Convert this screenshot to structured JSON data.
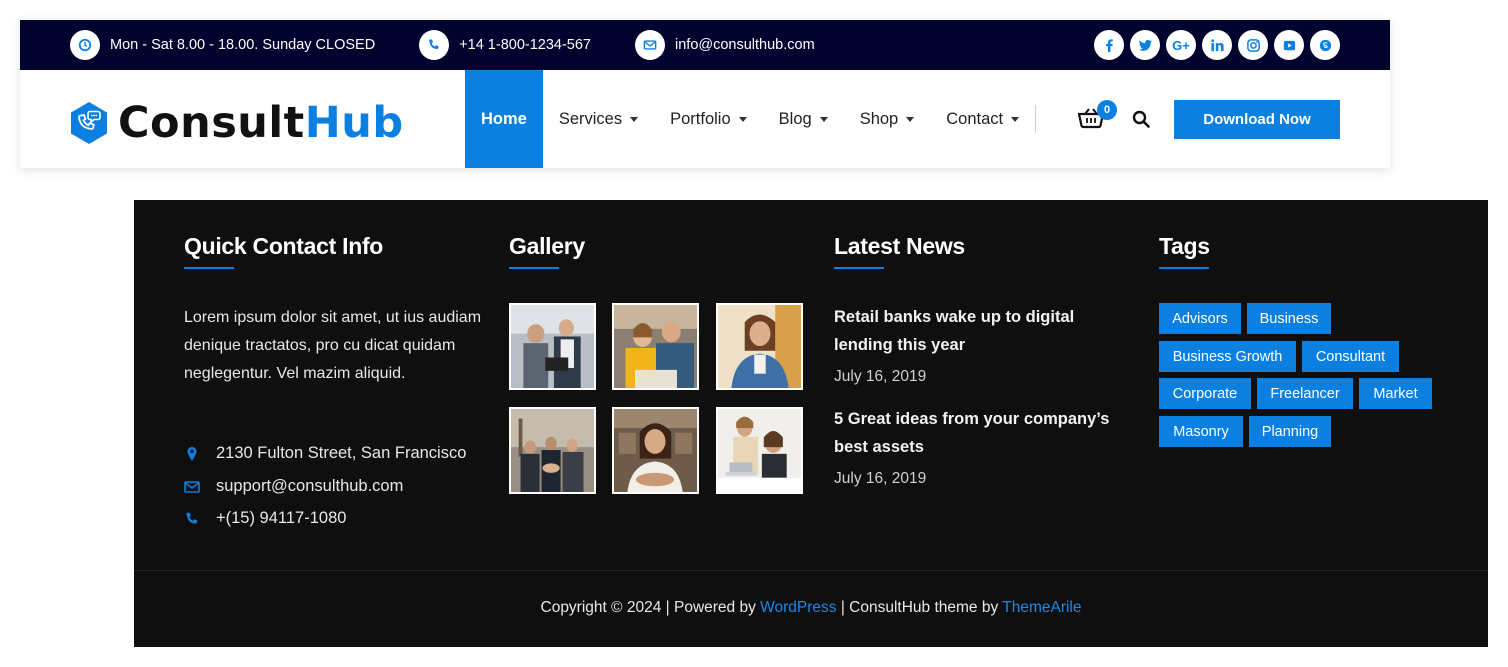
{
  "topbar": {
    "hours": "Mon - Sat 8.00 - 18.00. Sunday CLOSED",
    "phone": "+14 1-800-1234-567",
    "email": "info@consulthub.com",
    "social_icons": [
      "facebook-icon",
      "twitter-icon",
      "google-plus-icon",
      "linkedin-icon",
      "instagram-icon",
      "youtube-icon",
      "skype-icon"
    ]
  },
  "logo": {
    "part1": "Consult",
    "part2": "Hub"
  },
  "nav": {
    "items": [
      {
        "label": "Home",
        "active": true,
        "dropdown": false
      },
      {
        "label": "Services",
        "dropdown": true
      },
      {
        "label": "Portfolio",
        "dropdown": true
      },
      {
        "label": "Blog",
        "dropdown": true
      },
      {
        "label": "Shop",
        "dropdown": true
      },
      {
        "label": "Contact",
        "dropdown": true
      }
    ],
    "cart_count": "0",
    "download_label": "Download Now"
  },
  "footer": {
    "contact": {
      "title": "Quick Contact Info",
      "text": "Lorem ipsum dolor sit amet, ut ius audiam denique tractatos, pro cu dicat quidam neglegentur. Vel mazim aliquid.",
      "address": "2130 Fulton Street, San Francisco",
      "email": "support@consulthub.com",
      "phone": "+(15) 94117-1080"
    },
    "gallery": {
      "title": "Gallery",
      "count": 6
    },
    "news": {
      "title": "Latest News",
      "items": [
        {
          "title": "Retail banks wake up to digital lending this year",
          "date": "July 16, 2019"
        },
        {
          "title": "5 Great ideas from your company’s best assets",
          "date": "July 16, 2019"
        }
      ]
    },
    "tags": {
      "title": "Tags",
      "items": [
        "Advisors",
        "Business",
        "Business Growth",
        "Consultant",
        "Corporate",
        "Freelancer",
        "Market",
        "Masonry",
        "Planning"
      ]
    },
    "copyright": {
      "prefix": "Copyright © 2024 | Powered by ",
      "link1": "WordPress",
      "middle": " | ConsultHub theme by ",
      "link2": "ThemeArile"
    }
  },
  "colors": {
    "accent": "#0b80e0",
    "topbar_bg": "#02022e",
    "footer_bg": "#0f0f10"
  }
}
